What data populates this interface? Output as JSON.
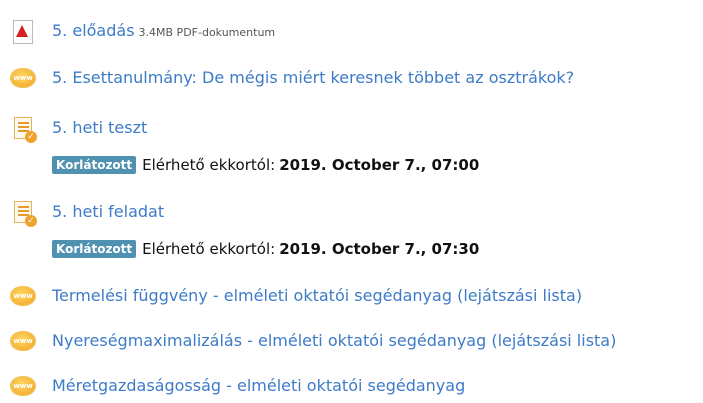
{
  "items": [
    {
      "title": "5. előadás",
      "meta": "3.4MB PDF-dokumentum",
      "icon": "pdf-icon"
    },
    {
      "title": "5. Esettanulmány: De mégis miért keresnek többet az osztrákok?",
      "icon": "url-icon"
    },
    {
      "title": "5. heti teszt",
      "icon": "quiz-icon",
      "restriction": {
        "badge": "Korlátozott",
        "label": "Elérhető ekkortól:",
        "date": "2019. October 7., 07:00"
      }
    },
    {
      "title": "5. heti feladat",
      "icon": "assignment-icon",
      "restriction": {
        "badge": "Korlátozott",
        "label": "Elérhető ekkortól:",
        "date": "2019. October 7., 07:30"
      }
    },
    {
      "title": "Termelési függvény - elméleti oktatói segédanyag (lejátszási lista)",
      "icon": "url-icon"
    },
    {
      "title": "Nyereségmaximalizálás - elméleti oktatói segédanyag (lejátszási lista)",
      "icon": "url-icon"
    },
    {
      "title": "Méretgazdaságosság - elméleti oktatói segédanyag",
      "icon": "url-icon"
    }
  ],
  "url_icon_text": "www",
  "check_mark": "✓",
  "colors": {
    "link": "#3d7bc8",
    "badge": "#4f91b0"
  }
}
